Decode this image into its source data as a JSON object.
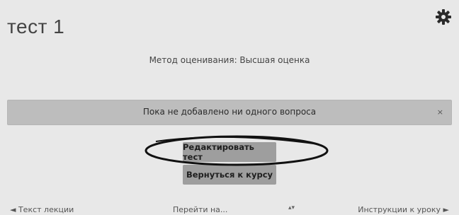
{
  "page": {
    "title": "тест 1",
    "settings_icon": "gear-icon"
  },
  "grading": {
    "text": "Метод оценивания: Высшая оценка"
  },
  "notice": {
    "text": "Пока не добавлено ни одного вопроса",
    "close_symbol": "×"
  },
  "actions": {
    "edit_label": "Редактировать тест",
    "back_label": "Вернуться к курсу"
  },
  "navigation": {
    "prev_label": "◄ Текст лекции",
    "jump_label": "Перейти на...",
    "jump_arrows": "▴▾",
    "next_label": "Инструкции к уроку ►"
  },
  "colors": {
    "background": "#e8e8e8",
    "banner": "#bdbdbd",
    "button": "#9e9e9e",
    "annotation_ellipse": "#111111"
  }
}
